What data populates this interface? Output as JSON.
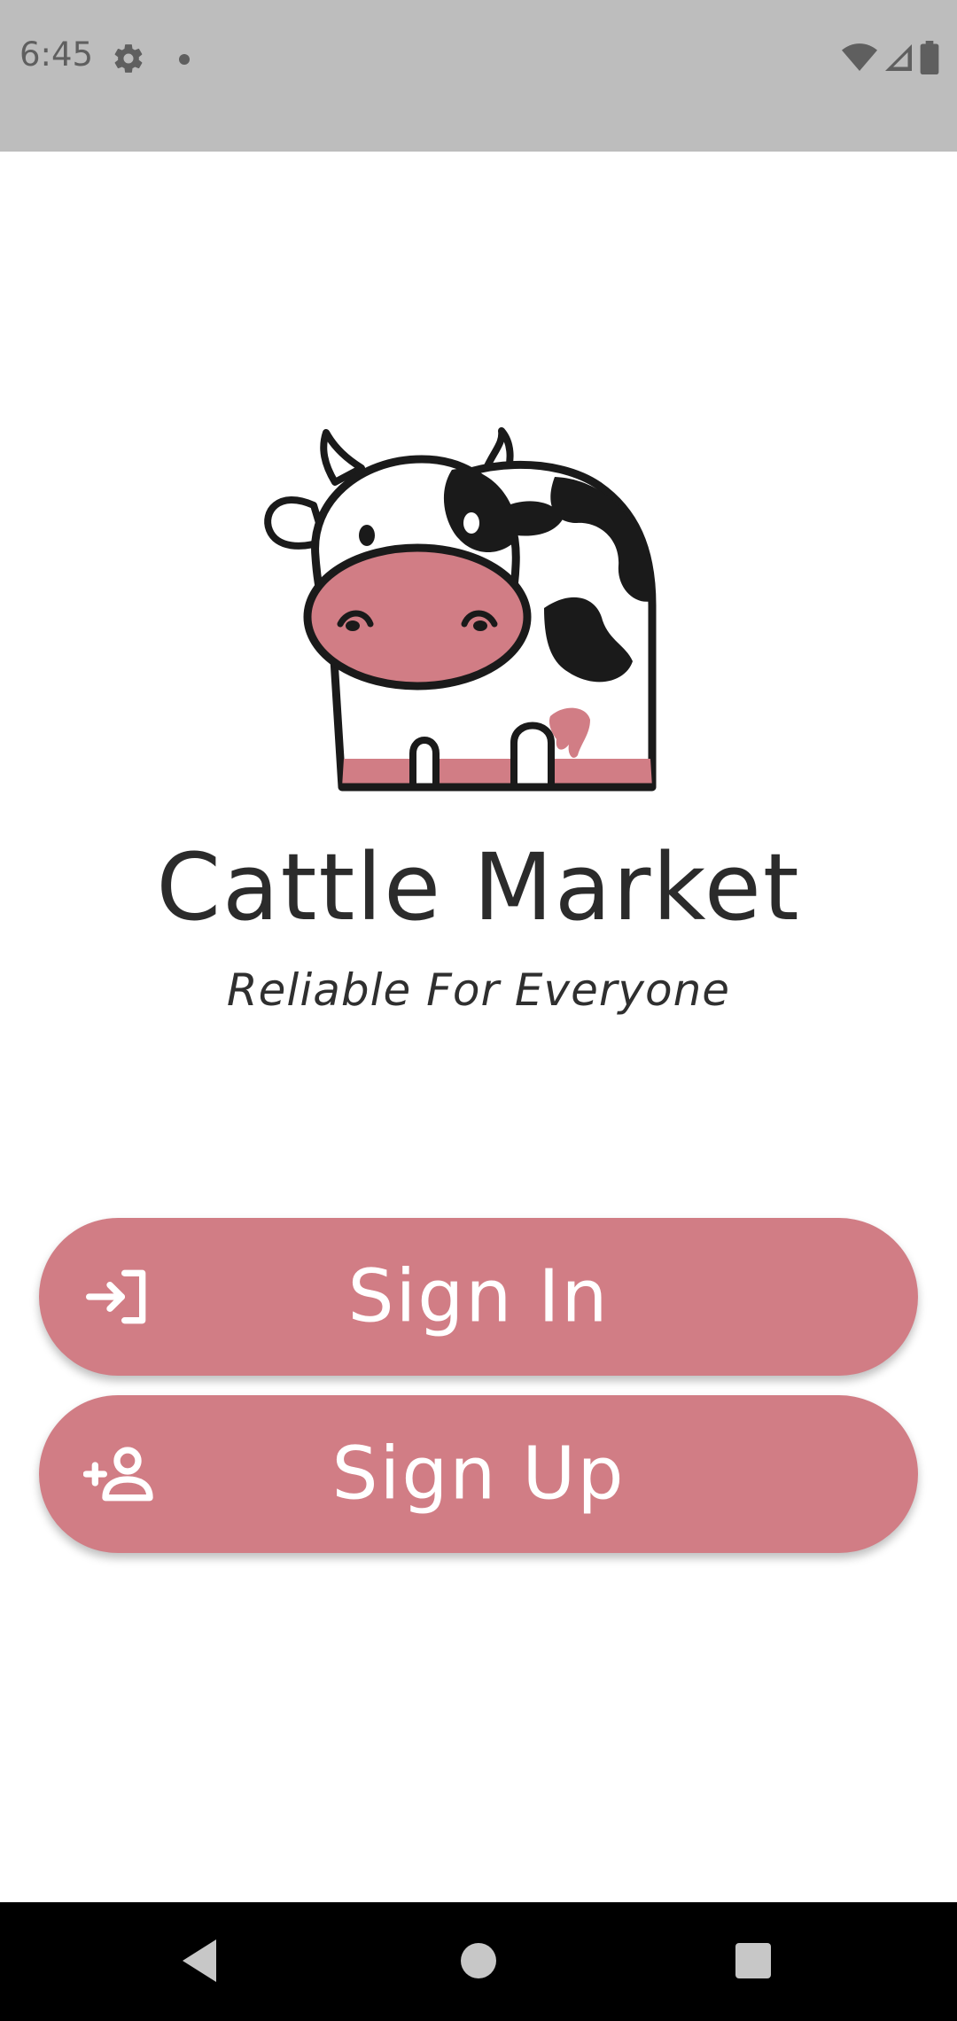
{
  "status_bar": {
    "time": "6:45",
    "left_icons": [
      "gear-icon",
      "notification-dot-icon"
    ],
    "right_icons": [
      "wifi-icon",
      "signal-icon",
      "battery-icon"
    ]
  },
  "app": {
    "title": "Cattle Market",
    "tagline": "Reliable For Everyone",
    "logo": "cow-logo"
  },
  "buttons": {
    "sign_in": {
      "label": "Sign In",
      "icon": "sign-in-icon"
    },
    "sign_up": {
      "label": "Sign Up",
      "icon": "add-user-icon"
    }
  },
  "nav_bar": {
    "icons": [
      "back-icon",
      "home-icon",
      "recents-icon"
    ]
  },
  "colors": {
    "accent": "#d17d85",
    "status_bar": "#bdbdbd",
    "nav_bar": "#000000",
    "text_dark": "#2b2b2b"
  }
}
